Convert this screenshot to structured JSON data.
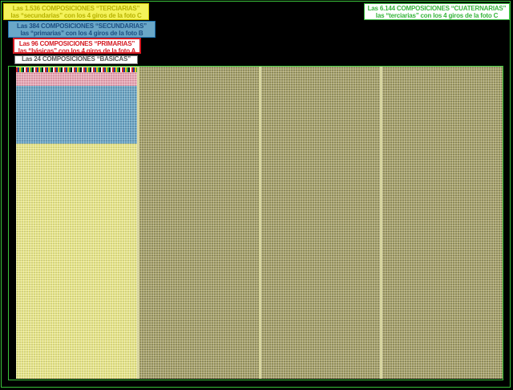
{
  "labels": {
    "terciarias": {
      "line1": "Las 1.536 COMPOSICIONES “TERCIARIAS”",
      "line2": "las “secundarias” con los 4 giros de la foto C"
    },
    "secundarias": {
      "line1": "Las 384 COMPOSICIONES “SECUNDARIAS”",
      "line2": "las “primarias” con los 4 giros de la foto B"
    },
    "primarias": {
      "line1": "Las 96 COMPOSICIONES “PRIMARIAS”",
      "line2": "las “básicas” con los 4 giros de la foto A"
    },
    "basicas": {
      "line1": "Las 24 COMPOSICIONES “BÁSICAS”"
    },
    "cuaternarias": {
      "line1": "Las 6.144 COMPOSICIONES “CUATERNARIAS”",
      "line2": "las “terciarias” con los 4 giros de la foto C"
    }
  },
  "colors": {
    "frame": "#3ac23a",
    "terciarias": "#e7e58a",
    "secundarias": "#6ea7c4",
    "primarias": "#e7a9b7",
    "cuaternarias": "#a9a46e"
  }
}
